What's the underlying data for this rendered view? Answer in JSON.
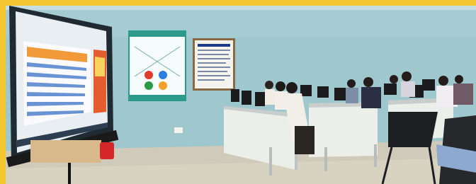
{
  "scene": {
    "description_free": true,
    "colors": {
      "border": "#f3c52f",
      "wall": "#9ec8cf",
      "floor": "#c9c6b7",
      "desk": "#eef0ee",
      "screen": "#2a73c9"
    },
    "icons": [
      "projector-screen",
      "poster-chart",
      "notice-board",
      "desktop-monitor",
      "chair",
      "person"
    ]
  }
}
